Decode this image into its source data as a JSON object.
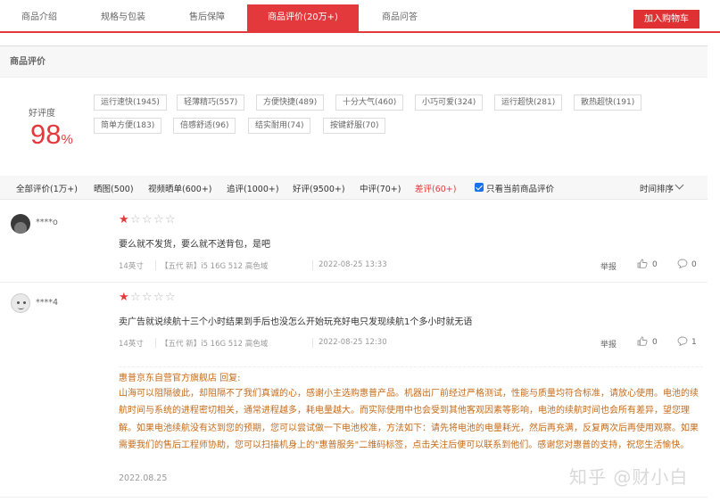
{
  "tabs": [
    {
      "label": "商品介绍",
      "active": false
    },
    {
      "label": "规格与包装",
      "active": false
    },
    {
      "label": "售后保障",
      "active": false
    },
    {
      "label": "商品评价(20万+)",
      "active": true
    },
    {
      "label": "商品问答",
      "active": false
    }
  ],
  "cart_button": "加入购物车",
  "section_title": "商品评价",
  "rating": {
    "label": "好评度",
    "value": "98",
    "unit": "%"
  },
  "tags": [
    "运行速快(1945)",
    "轻薄精巧(557)",
    "方便快捷(489)",
    "十分大气(460)",
    "小巧可爱(324)",
    "运行超快(281)",
    "散热超快(191)",
    "简单方便(183)",
    "倍感舒适(96)",
    "结实耐用(74)",
    "按键舒服(70)"
  ],
  "filters": [
    {
      "label": "全部评价(1万+)",
      "highlight": false
    },
    {
      "label": "晒图(500)",
      "highlight": false
    },
    {
      "label": "视频晒单(600+)",
      "highlight": false
    },
    {
      "label": "追评(1000+)",
      "highlight": false
    },
    {
      "label": "好评(9500+)",
      "highlight": false
    },
    {
      "label": "中评(70+)",
      "highlight": false
    },
    {
      "label": "差评(60+)",
      "highlight": true
    }
  ],
  "current_only_label": "只看当前商品评价",
  "sort_label": "时间排序",
  "reviews": [
    {
      "user": "****o",
      "stars": 1,
      "text": "要么就不发货，要么就不送背包，是吧",
      "size": "14英寸",
      "spec": "【五代 新】i5 16G 512 高色域",
      "time": "2022-08-25 13:33",
      "report": "举报",
      "likes": "0",
      "replies": "0"
    },
    {
      "user": "****4",
      "stars": 1,
      "text": "卖广告就说续航十三个小时结果到手后也没怎么开始玩充好电只发现续航1个多小时就无语",
      "size": "14英寸",
      "spec": "【五代 新】i5 16G 512 高色域",
      "time": "2022-08-25 12:30",
      "report": "举报",
      "likes": "0",
      "replies": "1"
    }
  ],
  "merchant": {
    "name": "惠普京东自营官方旗舰店 回复:",
    "reply": "山海可以阻隔彼此，却阻隔不了我们真诚的心，感谢小主选购惠普产品。机器出厂前经过严格测试，性能与质量均符合标准，请放心使用。电池的续航时间与系统的进程密切相关，通常进程越多，耗电量越大。而实际使用中也会受到其他客观因素等影响，电池的续航时间也会所有差异，望您理解。如果电池续航没有达到您的预期，您可以尝试做一下电池校准，方法如下：请先将电池的电量耗光，然后再充满，反复两次后再使用观察。如果需要我们的售后工程师协助，您可以扫描机身上的\"惠普服务\"二维码标签，点击关注后便可以联系到他们。感谢您对惠普的支持，祝您生活愉快。",
    "date": "2022.08.25"
  },
  "watermark": "知乎 @财小白",
  "colors": {
    "accent": "#e4393c",
    "merchant_text": "#c56b19"
  }
}
